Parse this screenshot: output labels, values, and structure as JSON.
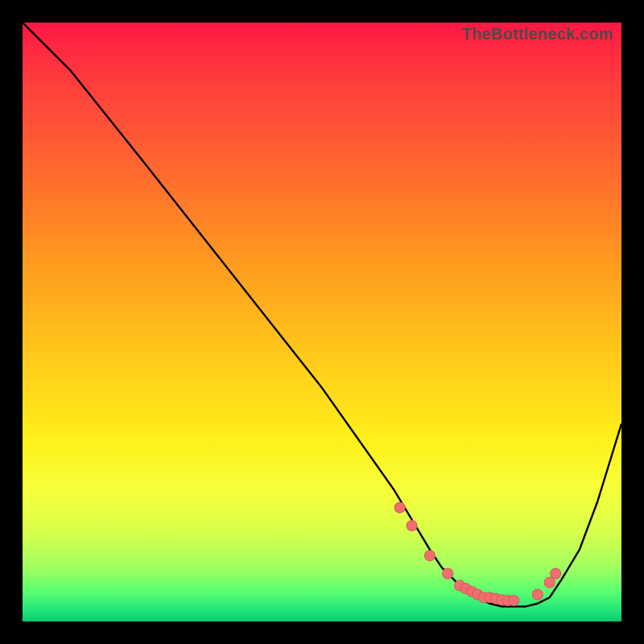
{
  "watermark": "TheBottleneck.com",
  "colors": {
    "background": "#000000",
    "curve_stroke": "#000000",
    "marker_fill": "#ef6f6f",
    "marker_stroke": "#d85a5a"
  },
  "chart_data": {
    "type": "line",
    "title": "",
    "xlabel": "",
    "ylabel": "",
    "xlim": [
      0,
      100
    ],
    "ylim": [
      0,
      100
    ],
    "series": [
      {
        "name": "bottleneck-curve",
        "x": [
          0,
          8,
          20,
          35,
          50,
          62,
          65,
          68,
          70,
          72,
          74,
          76,
          78,
          80,
          82,
          84,
          86,
          88,
          90,
          93,
          96,
          100
        ],
        "y": [
          100,
          92,
          77,
          58,
          39,
          22,
          17,
          12,
          9,
          7,
          5,
          4,
          3,
          2.5,
          2.5,
          2.5,
          3,
          4,
          7,
          12,
          20,
          33
        ]
      }
    ],
    "markers": {
      "name": "highlight-points",
      "x": [
        63,
        65,
        68,
        71,
        73,
        74,
        75,
        76,
        77,
        78,
        79,
        80,
        81,
        82,
        86,
        88,
        89
      ],
      "y": [
        19,
        16,
        11,
        8,
        6,
        5.5,
        5,
        4.5,
        4,
        4,
        3.8,
        3.6,
        3.5,
        3.5,
        4.5,
        6.5,
        8
      ]
    }
  }
}
